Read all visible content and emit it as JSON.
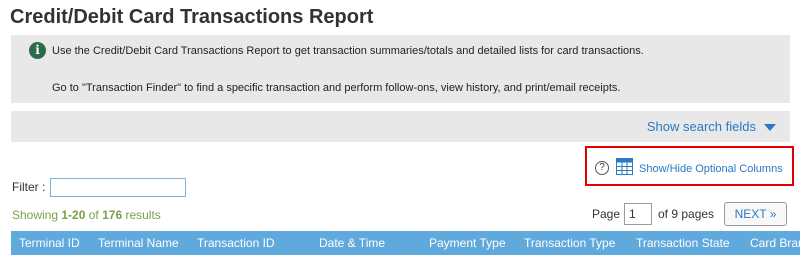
{
  "page": {
    "title": "Credit/Debit Card Transactions Report"
  },
  "info": {
    "icon": "info-icon",
    "icon_glyph": "i",
    "line1": "Use the Credit/Debit Card Transactions Report to get transaction summaries/totals and detailed lists for card transactions.",
    "line2": "Go to \"Transaction Finder\" to find a specific transaction and perform follow-ons, view history, and print/email receipts."
  },
  "search": {
    "toggle_label": "Show search fields",
    "icon": "caret-down-icon"
  },
  "columns_toggle": {
    "help_glyph": "?",
    "icon": "table-columns-icon",
    "label": "Show/Hide Optional Columns"
  },
  "filter": {
    "label": "Filter :",
    "value": "",
    "placeholder": ""
  },
  "results": {
    "prefix": "Showing ",
    "range": "1-20",
    "middle": " of ",
    "total": "176",
    "suffix": " results"
  },
  "pager": {
    "page_label": "Page",
    "current_page": "1",
    "of_label": "of 9 pages",
    "next_label": "NEXT »"
  },
  "table": {
    "columns": [
      "Terminal ID",
      "Terminal Name",
      "Transaction ID",
      "Date & Time",
      "Payment Type",
      "Transaction Type",
      "Transaction State",
      "Card Brand"
    ]
  },
  "colors": {
    "link": "#2a79c4",
    "header_bg": "#5fa9dc",
    "highlight_border": "#e00000",
    "results_text": "#7aa04a",
    "info_icon": "#2d6a4c"
  }
}
